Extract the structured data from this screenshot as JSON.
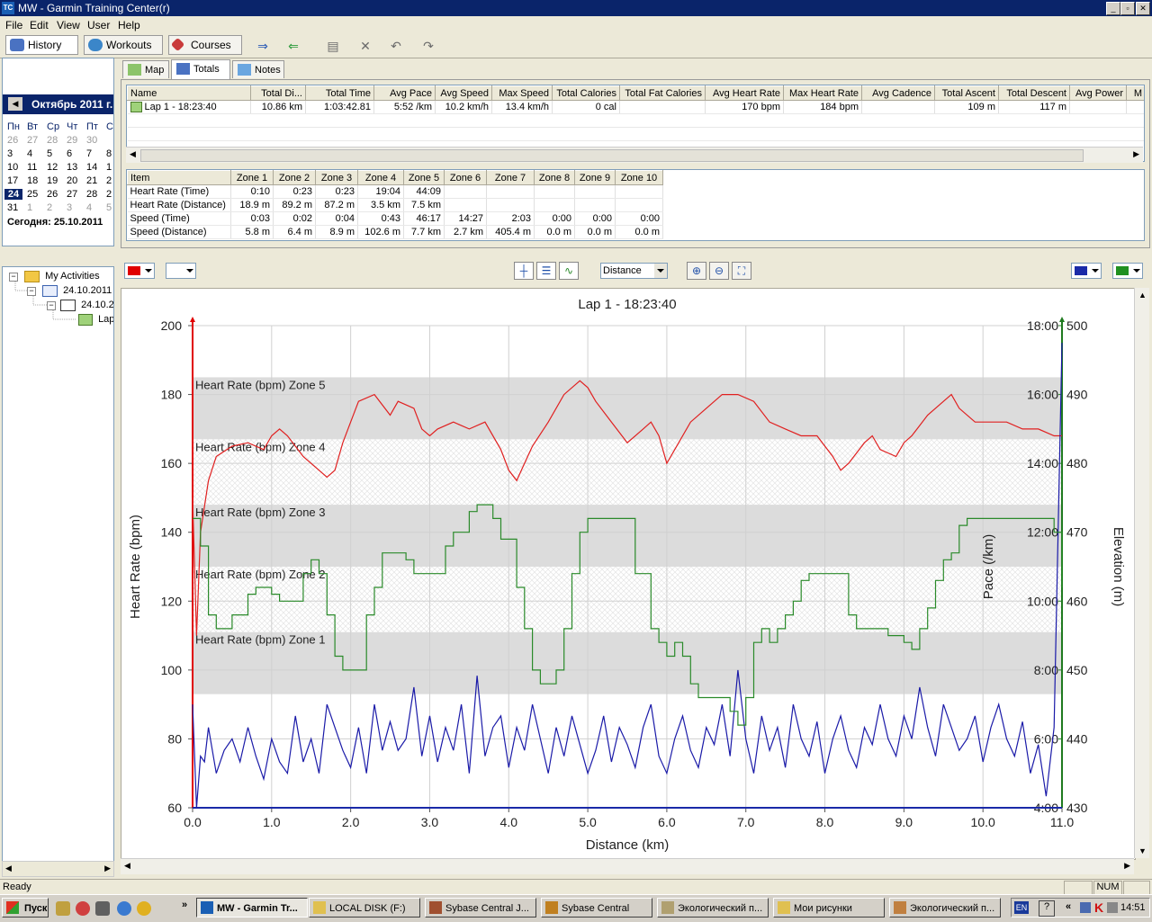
{
  "window": {
    "title": "MW - Garmin Training Center(r)",
    "icon": "TC"
  },
  "menu": [
    "File",
    "Edit",
    "View",
    "User",
    "Help"
  ],
  "toolbar": {
    "history": "History",
    "workouts": "Workouts",
    "courses": "Courses"
  },
  "calendar": {
    "month": "Октябрь 2011 г.",
    "dow": [
      "Пн",
      "Вт",
      "Ср",
      "Чт",
      "Пт",
      "С"
    ],
    "rows": [
      [
        "26",
        "27",
        "28",
        "29",
        "30",
        ""
      ],
      [
        "3",
        "4",
        "5",
        "6",
        "7",
        "8"
      ],
      [
        "10",
        "11",
        "12",
        "13",
        "14",
        "1"
      ],
      [
        "17",
        "18",
        "19",
        "20",
        "21",
        "2"
      ],
      [
        "24",
        "25",
        "26",
        "27",
        "28",
        "2"
      ],
      [
        "31",
        "1",
        "2",
        "3",
        "4",
        "5"
      ]
    ],
    "selected_day": "24",
    "today": "Сегодня: 25.10.2011"
  },
  "tree": {
    "root": "My Activities",
    "child1": "24.10.2011",
    "child2": "24.10.2",
    "leaf": "Lap"
  },
  "tabs": {
    "map": "Map",
    "totals": "Totals",
    "notes": "Notes"
  },
  "totals": {
    "headers": [
      "Name",
      "Total Di...",
      "Total Time",
      "Avg Pace",
      "Avg Speed",
      "Max Speed",
      "Total Calories",
      "Total Fat Calories",
      "Avg Heart Rate",
      "Max Heart Rate",
      "Avg Cadence",
      "Total Ascent",
      "Total Descent",
      "Avg Power",
      "M"
    ],
    "row": [
      "Lap 1 - 18:23:40",
      "10.86 km",
      "1:03:42.81",
      "5:52 /km",
      "10.2 km/h",
      "13.4 km/h",
      "0 cal",
      "",
      "170 bpm",
      "184 bpm",
      "",
      "109 m",
      "117 m",
      "",
      ""
    ]
  },
  "zones": {
    "headers": [
      "Item",
      "Zone 1",
      "Zone 2",
      "Zone 3",
      "Zone 4",
      "Zone 5",
      "Zone 6",
      "Zone 7",
      "Zone 8",
      "Zone 9",
      "Zone 10"
    ],
    "rows": [
      [
        "Heart Rate (Time)",
        "0:10",
        "0:23",
        "0:23",
        "19:04",
        "44:09",
        "",
        "",
        "",
        "",
        ""
      ],
      [
        "Heart Rate (Distance)",
        "18.9 m",
        "89.2 m",
        "87.2 m",
        "3.5 km",
        "7.5 km",
        "",
        "",
        "",
        "",
        ""
      ],
      [
        "Speed (Time)",
        "0:03",
        "0:02",
        "0:04",
        "0:43",
        "46:17",
        "14:27",
        "2:03",
        "0:00",
        "0:00",
        "0:00"
      ],
      [
        "Speed (Distance)",
        "5.8 m",
        "6.4 m",
        "8.9 m",
        "102.6 m",
        "7.7 km",
        "2.7 km",
        "405.4 m",
        "0.0 m",
        "0.0 m",
        "0.0 m"
      ]
    ]
  },
  "graph_toolbar": {
    "x_axis_select": "Distance"
  },
  "colors": {
    "heart_rate": "#e02020",
    "pace": "#1a1aa8",
    "elevation": "#2a8a2a"
  },
  "chart_data": {
    "type": "line",
    "title": "Lap 1 - 18:23:40",
    "xlabel": "Distance (km)",
    "ylabel_left": "Heart Rate (bpm)",
    "ylabel_right1": "Pace (/km)",
    "ylabel_right2": "Elevation (m)",
    "xlim": [
      0,
      11
    ],
    "ylim_left": [
      60,
      200
    ],
    "ylim_elev": [
      430,
      500
    ],
    "x_ticks": [
      "0.0",
      "1.0",
      "2.0",
      "3.0",
      "4.0",
      "5.0",
      "6.0",
      "7.0",
      "8.0",
      "9.0",
      "10.0",
      "11.0"
    ],
    "y_ticks_left": [
      "60",
      "80",
      "100",
      "120",
      "140",
      "160",
      "180",
      "200"
    ],
    "y_ticks_pace": [
      "4:00",
      "6:00",
      "8:00",
      "10:00",
      "12:00",
      "14:00",
      "16:00",
      "18:00"
    ],
    "y_ticks_elev": [
      "430",
      "440",
      "450",
      "460",
      "470",
      "480",
      "490",
      "500"
    ],
    "grid": true,
    "zones": [
      {
        "label": "Heart Rate (bpm) Zone 5",
        "from": 167,
        "to": 185
      },
      {
        "label": "Heart Rate (bpm) Zone 4",
        "from": 148,
        "to": 167
      },
      {
        "label": "Heart Rate (bpm) Zone 3",
        "from": 130,
        "to": 148
      },
      {
        "label": "Heart Rate (bpm) Zone 2",
        "from": 111,
        "to": 130
      },
      {
        "label": "Heart Rate (bpm) Zone 1",
        "from": 93,
        "to": 111
      }
    ],
    "series": [
      {
        "axis": "left",
        "x": [
          0,
          0.05,
          0.1,
          0.2,
          0.3,
          0.5,
          0.7,
          0.9,
          1.0,
          1.1,
          1.2,
          1.4,
          1.6,
          1.7,
          1.8,
          1.9,
          2.0,
          2.1,
          2.3,
          2.5,
          2.6,
          2.8,
          2.9,
          3.0,
          3.1,
          3.3,
          3.5,
          3.7,
          3.9,
          4.0,
          4.1,
          4.2,
          4.3,
          4.5,
          4.7,
          4.9,
          5.0,
          5.1,
          5.3,
          5.5,
          5.7,
          5.8,
          5.9,
          6.0,
          6.1,
          6.3,
          6.5,
          6.7,
          6.9,
          7.1,
          7.3,
          7.5,
          7.7,
          7.9,
          8.1,
          8.2,
          8.3,
          8.5,
          8.6,
          8.7,
          8.9,
          9.0,
          9.1,
          9.3,
          9.5,
          9.6,
          9.7,
          9.9,
          10.1,
          10.3,
          10.5,
          10.7,
          10.9,
          11.0
        ],
        "values": [
          150,
          110,
          140,
          155,
          162,
          165,
          166,
          164,
          168,
          170,
          168,
          162,
          158,
          156,
          158,
          166,
          172,
          178,
          180,
          174,
          178,
          176,
          170,
          168,
          170,
          172,
          170,
          172,
          164,
          158,
          155,
          160,
          165,
          172,
          180,
          184,
          182,
          178,
          172,
          166,
          170,
          172,
          168,
          160,
          164,
          172,
          176,
          180,
          180,
          178,
          172,
          170,
          168,
          168,
          162,
          158,
          160,
          166,
          168,
          164,
          162,
          166,
          168,
          174,
          178,
          180,
          176,
          172,
          172,
          172,
          170,
          170,
          168,
          168
        ]
      },
      {
        "axis": "pace",
        "x": [
          0,
          0.05,
          0.1,
          0.15,
          0.2,
          0.3,
          0.4,
          0.5,
          0.6,
          0.7,
          0.8,
          0.9,
          1.0,
          1.1,
          1.2,
          1.3,
          1.4,
          1.5,
          1.6,
          1.7,
          1.8,
          1.9,
          2.0,
          2.1,
          2.2,
          2.3,
          2.4,
          2.5,
          2.6,
          2.7,
          2.8,
          2.9,
          3.0,
          3.1,
          3.2,
          3.3,
          3.4,
          3.5,
          3.6,
          3.7,
          3.8,
          3.9,
          4.0,
          4.1,
          4.2,
          4.3,
          4.4,
          4.5,
          4.6,
          4.7,
          4.8,
          4.9,
          5.0,
          5.1,
          5.2,
          5.3,
          5.4,
          5.5,
          5.6,
          5.7,
          5.8,
          5.9,
          6.0,
          6.1,
          6.2,
          6.3,
          6.4,
          6.5,
          6.6,
          6.7,
          6.8,
          6.9,
          7.0,
          7.1,
          7.2,
          7.3,
          7.4,
          7.5,
          7.6,
          7.7,
          7.8,
          7.9,
          8.0,
          8.1,
          8.2,
          8.3,
          8.4,
          8.5,
          8.6,
          8.7,
          8.8,
          8.9,
          9.0,
          9.1,
          9.2,
          9.3,
          9.4,
          9.5,
          9.6,
          9.7,
          9.8,
          9.9,
          10.0,
          10.1,
          10.2,
          10.3,
          10.4,
          10.5,
          10.6,
          10.7,
          10.8,
          10.9,
          11.0
        ],
        "values": [
          420,
          160,
          330,
          320,
          380,
          300,
          340,
          360,
          320,
          380,
          330,
          290,
          360,
          320,
          300,
          400,
          320,
          360,
          300,
          420,
          380,
          340,
          310,
          380,
          300,
          420,
          340,
          390,
          340,
          360,
          450,
          330,
          400,
          320,
          380,
          340,
          420,
          300,
          470,
          330,
          380,
          400,
          310,
          380,
          340,
          420,
          360,
          300,
          380,
          330,
          400,
          350,
          300,
          340,
          400,
          320,
          380,
          350,
          310,
          380,
          420,
          330,
          300,
          360,
          400,
          340,
          310,
          380,
          350,
          420,
          330,
          480,
          360,
          300,
          400,
          340,
          380,
          310,
          420,
          360,
          330,
          390,
          300,
          360,
          400,
          340,
          310,
          380,
          350,
          420,
          360,
          330,
          400,
          360,
          450,
          380,
          330,
          420,
          380,
          340,
          360,
          400,
          320,
          380,
          420,
          360,
          330,
          390,
          300,
          350,
          260,
          380,
          1050
        ]
      },
      {
        "axis": "elev",
        "x": [
          0,
          0.1,
          0.2,
          0.3,
          0.4,
          0.5,
          0.7,
          0.8,
          1.0,
          1.1,
          1.3,
          1.4,
          1.5,
          1.6,
          1.7,
          1.8,
          1.9,
          2.0,
          2.2,
          2.3,
          2.4,
          2.6,
          2.7,
          2.8,
          3.0,
          3.2,
          3.3,
          3.5,
          3.6,
          3.7,
          3.8,
          3.9,
          4.1,
          4.2,
          4.3,
          4.4,
          4.5,
          4.6,
          4.7,
          4.8,
          4.9,
          5.0,
          5.1,
          5.2,
          5.4,
          5.6,
          5.8,
          5.9,
          6.0,
          6.1,
          6.2,
          6.3,
          6.4,
          6.5,
          6.6,
          6.7,
          6.8,
          6.9,
          7.0,
          7.1,
          7.2,
          7.3,
          7.4,
          7.5,
          7.6,
          7.7,
          7.8,
          8.0,
          8.2,
          8.3,
          8.4,
          8.6,
          8.8,
          9.0,
          9.1,
          9.2,
          9.3,
          9.4,
          9.5,
          9.6,
          9.7,
          9.8,
          9.9,
          10.0,
          10.1,
          10.2,
          10.3,
          10.5,
          10.7,
          10.8,
          10.9,
          11.0
        ],
        "values": [
          472,
          468,
          458,
          456,
          456,
          458,
          461,
          462,
          461,
          460,
          460,
          464,
          466,
          464,
          458,
          452,
          450,
          450,
          458,
          462,
          467,
          467,
          466,
          464,
          464,
          468,
          470,
          473,
          474,
          474,
          472,
          469,
          462,
          456,
          450,
          448,
          448,
          450,
          456,
          464,
          470,
          472,
          472,
          472,
          472,
          464,
          456,
          454,
          452,
          454,
          452,
          448,
          446,
          446,
          446,
          446,
          444,
          442,
          446,
          454,
          456,
          454,
          456,
          458,
          460,
          463,
          464,
          464,
          464,
          458,
          456,
          456,
          455,
          454,
          453,
          456,
          459,
          463,
          466,
          467,
          471,
          472,
          472,
          472,
          472,
          472,
          472,
          472,
          472,
          472,
          470,
          462
        ]
      }
    ]
  },
  "statusbar": {
    "text": "Ready",
    "num": "NUM"
  },
  "taskbar": {
    "start": "Пуск",
    "tasks": [
      "MW - Garmin Tr...",
      "LOCAL DISK (F:)",
      "Sybase Central J...",
      "Sybase Central",
      "Экологический п...",
      "Мои рисунки",
      "Экологический п..."
    ],
    "lang": "EN",
    "clock": "14:51"
  }
}
